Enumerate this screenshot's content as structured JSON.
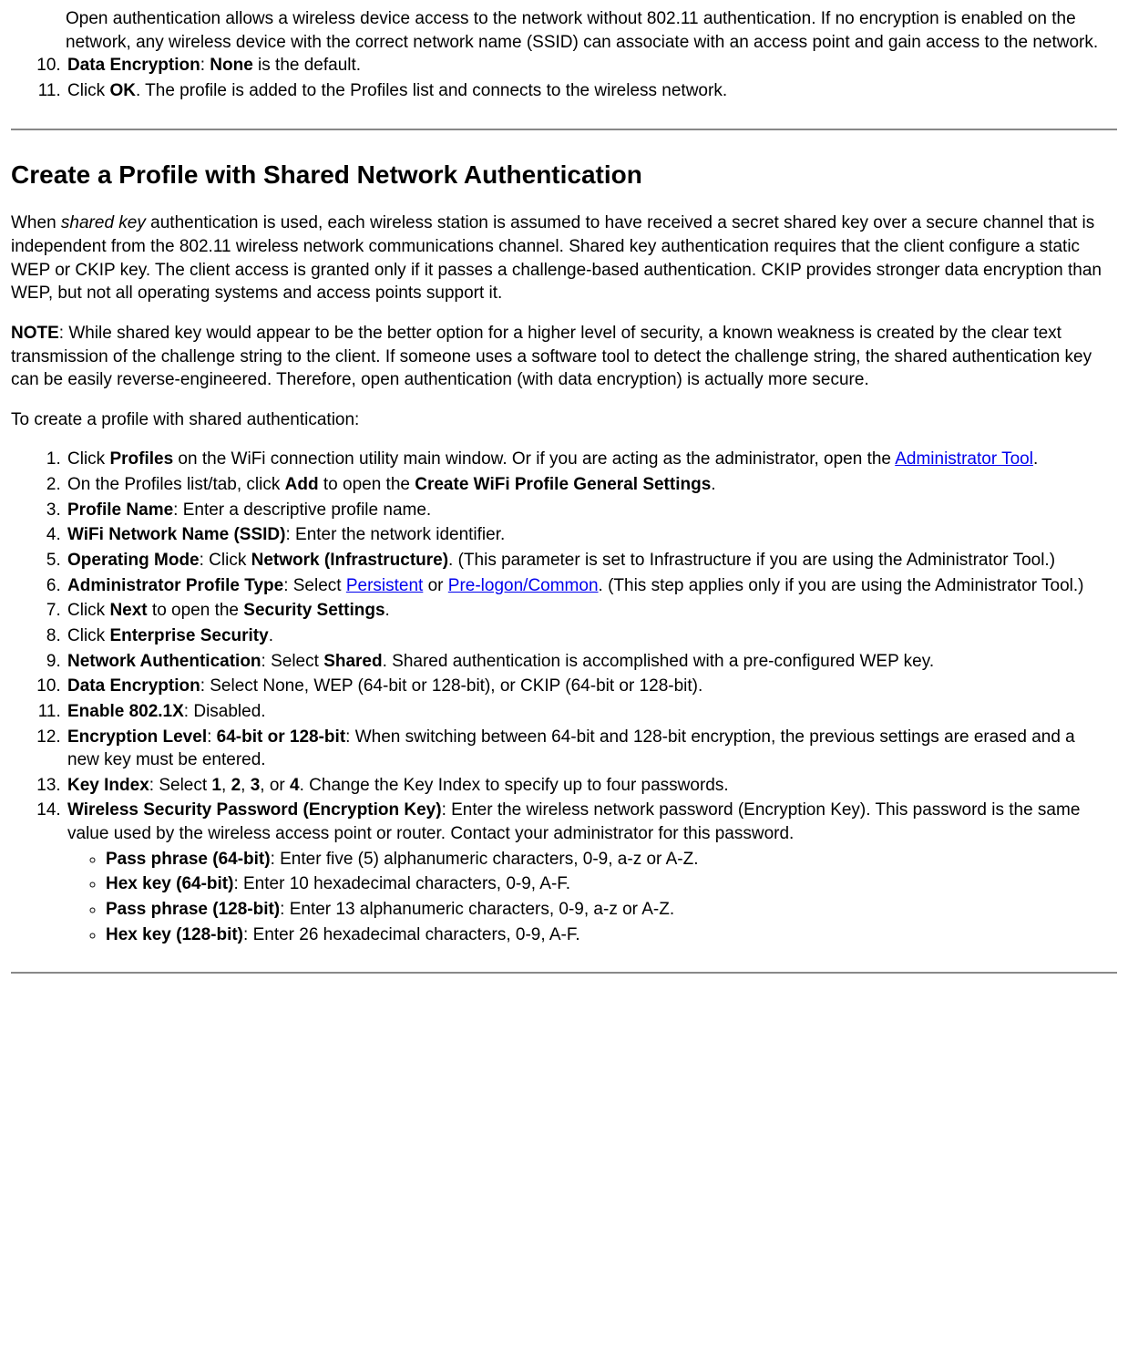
{
  "top_paragraph": "Open authentication allows a wireless device access to the network without 802.11 authentication. If no encryption is enabled on the network, any wireless device with the correct network name (SSID) can associate with an access point and gain access to the network.",
  "top_list": {
    "item10": {
      "b1": "Data Encryption",
      "colon": ": ",
      "b2": "None",
      "rest": " is the default."
    },
    "item11": {
      "pre": "Click ",
      "b1": "OK",
      "rest": ". The profile is added to the Profiles list and connects to the wireless network."
    }
  },
  "heading": "Create a Profile with Shared Network Authentication",
  "para1": {
    "pre": "When ",
    "em": "shared key",
    "rest": " authentication is used, each wireless station is assumed to have received a secret shared key over a secure channel that is independent from the 802.11 wireless network communications channel. Shared key authentication requires that the client configure a static WEP or CKIP key. The client access is granted only if it passes a challenge-based authentication. CKIP provides stronger data encryption than WEP, but not all operating systems and access points support it."
  },
  "para2": {
    "b": "NOTE",
    "rest": ": While shared key would appear to be the better option for a higher level of security, a known weakness is created by the clear text transmission of the challenge string to the client. If someone uses a software tool to detect the challenge string, the shared authentication key can be easily reverse-engineered. Therefore, open authentication (with data encryption) is actually more secure."
  },
  "para3": "To create a profile with shared authentication:",
  "steps": {
    "s1": {
      "pre": "Click ",
      "b1": "Profiles",
      "mid": " on the WiFi connection utility main window. Or if you are acting as the administrator, open the ",
      "link": "Administrator Tool",
      "post": "."
    },
    "s2": {
      "pre": "On the Profiles list/tab, click ",
      "b1": "Add",
      "mid": " to open the ",
      "b2": "Create WiFi Profile General Settings",
      "post": "."
    },
    "s3": {
      "b1": "Profile Name",
      "rest": ": Enter a descriptive profile name."
    },
    "s4": {
      "b1": "WiFi Network Name (SSID)",
      "rest": ": Enter the network identifier."
    },
    "s5": {
      "b1": "Operating Mode",
      "mid": ": Click ",
      "b2": "Network (Infrastructure)",
      "rest": ". (This parameter is set to Infrastructure if you are using the Administrator Tool.)"
    },
    "s6": {
      "b1": "Administrator Profile Type",
      "mid": ": Select ",
      "link1": "Persistent",
      "or": " or ",
      "link2": "Pre-logon/Common",
      "rest": ". (This step applies only if you are using the Administrator Tool.)"
    },
    "s7": {
      "pre": "Click ",
      "b1": "Next",
      "mid": " to open the ",
      "b2": "Security Settings",
      "post": "."
    },
    "s8": {
      "pre": "Click ",
      "b1": "Enterprise Security",
      "post": "."
    },
    "s9": {
      "b1": "Network Authentication",
      "mid": ": Select ",
      "b2": "Shared",
      "rest": ". Shared authentication is accomplished with a pre-configured WEP key."
    },
    "s10": {
      "b1": "Data Encryption",
      "rest": ": Select None, WEP (64-bit or 128-bit), or CKIP (64-bit or 128-bit)."
    },
    "s11": {
      "b1": "Enable 802.1X",
      "rest": ": Disabled."
    },
    "s12": {
      "b1": "Encryption Level",
      "colon": ": ",
      "b2": "64-bit or 128-bit",
      "rest": ": When switching between 64-bit and 128-bit encryption, the previous settings are erased and a new key must be entered."
    },
    "s13": {
      "b1": "Key Index",
      "mid": ": Select ",
      "b2": "1",
      "c1": ", ",
      "b3": "2",
      "c2": ", ",
      "b4": "3",
      "c3": ", or ",
      "b5": "4",
      "rest": ". Change the Key Index to specify up to four passwords."
    },
    "s14": {
      "b1": "Wireless Security Password (Encryption Key)",
      "rest": ": Enter the wireless network password (Encryption Key). This password is the same value used by the wireless access point or router. Contact your administrator for this password.",
      "sub": {
        "a": {
          "b": "Pass phrase (64-bit)",
          "rest": ": Enter five (5) alphanumeric characters, 0-9, a-z or A-Z."
        },
        "b": {
          "b": "Hex key (64-bit)",
          "rest": ": Enter 10 hexadecimal characters, 0-9, A-F."
        },
        "c": {
          "b": "Pass phrase (128-bit)",
          "rest": ": Enter 13 alphanumeric characters, 0-9, a-z or A-Z."
        },
        "d": {
          "b": "Hex key (128-bit)",
          "rest": ": Enter 26 hexadecimal characters, 0-9, A-F."
        }
      }
    }
  }
}
